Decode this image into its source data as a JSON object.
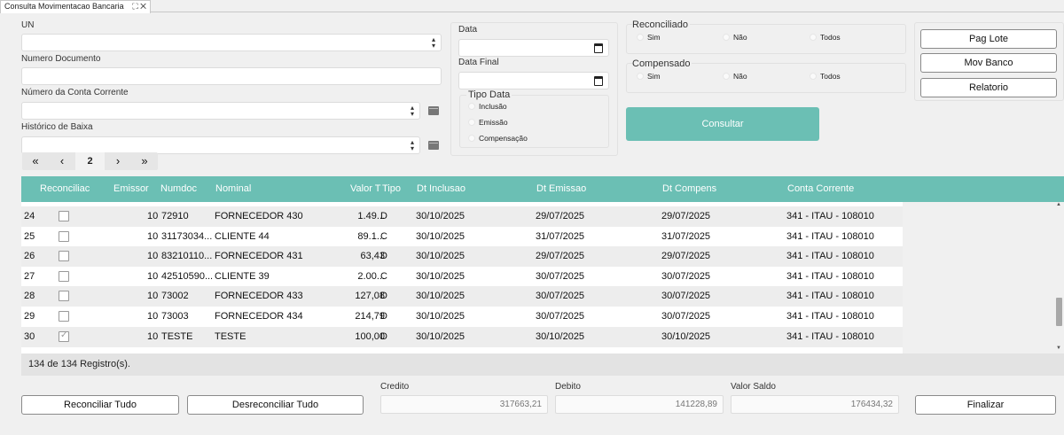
{
  "tab": {
    "title": "Consulta Movimentacao Bancaria",
    "icons": "⛶ ✕"
  },
  "filters": {
    "un_label": "UN",
    "numero_documento_label": "Numero Documento",
    "conta_corrente_label": "Número da Conta Corrente",
    "historico_baixa_label": "Histórico de Baixa",
    "data_label": "Data",
    "data_final_label": "Data Final",
    "tipo_data": {
      "label": "Tipo Data",
      "options": [
        "Inclusão",
        "Emissão",
        "Compensação"
      ]
    },
    "reconciliado": {
      "label": "Reconciliado",
      "options": [
        "Sim",
        "Não",
        "Todos"
      ]
    },
    "compensado": {
      "label": "Compensado",
      "options": [
        "Sim",
        "Não",
        "Todos"
      ]
    }
  },
  "actions": {
    "pag_lote": "Pag Lote",
    "mov_banco": "Mov Banco",
    "relatorio": "Relatorio",
    "consultar": "Consultar"
  },
  "pager": {
    "first": "«",
    "prev": "‹",
    "page": "2",
    "next": "›",
    "last": "»"
  },
  "grid": {
    "columns": [
      "Reconciliac",
      "Emissor",
      "Numdoc",
      "Nominal",
      "Valor T",
      "Tipo",
      "Dt Inclusao",
      "Dt Emissao",
      "Dt Compens",
      "Conta Corrente"
    ],
    "rows": [
      {
        "num": "24",
        "checked": false,
        "emissor": "10",
        "numdoc": "72910",
        "nominal": "FORNECEDOR 430",
        "valor": "1.49...",
        "tipo": "D",
        "dt_inclusao": "30/10/2025",
        "dt_emissao": "29/07/2025",
        "dt_compens": "29/07/2025",
        "conta": "341 - ITAU - 108010"
      },
      {
        "num": "25",
        "checked": false,
        "emissor": "10",
        "numdoc": "31173034...",
        "nominal": "CLIENTE 44",
        "valor": "89.1...",
        "tipo": "C",
        "dt_inclusao": "30/10/2025",
        "dt_emissao": "31/07/2025",
        "dt_compens": "31/07/2025",
        "conta": "341 - ITAU - 108010"
      },
      {
        "num": "26",
        "checked": false,
        "emissor": "10",
        "numdoc": "83210110...",
        "nominal": "FORNECEDOR 431",
        "valor": "63,43",
        "tipo": "D",
        "dt_inclusao": "30/10/2025",
        "dt_emissao": "29/07/2025",
        "dt_compens": "29/07/2025",
        "conta": "341 - ITAU - 108010"
      },
      {
        "num": "27",
        "checked": false,
        "emissor": "10",
        "numdoc": "42510590...",
        "nominal": "CLIENTE 39",
        "valor": "2.00...",
        "tipo": "C",
        "dt_inclusao": "30/10/2025",
        "dt_emissao": "30/07/2025",
        "dt_compens": "30/07/2025",
        "conta": "341 - ITAU - 108010"
      },
      {
        "num": "28",
        "checked": false,
        "emissor": "10",
        "numdoc": "73002",
        "nominal": "FORNECEDOR 433",
        "valor": "127,08",
        "tipo": "D",
        "dt_inclusao": "30/10/2025",
        "dt_emissao": "30/07/2025",
        "dt_compens": "30/07/2025",
        "conta": "341 - ITAU - 108010"
      },
      {
        "num": "29",
        "checked": false,
        "emissor": "10",
        "numdoc": "73003",
        "nominal": "FORNECEDOR 434",
        "valor": "214,79",
        "tipo": "D",
        "dt_inclusao": "30/10/2025",
        "dt_emissao": "30/07/2025",
        "dt_compens": "30/07/2025",
        "conta": "341 - ITAU - 108010"
      },
      {
        "num": "30",
        "checked": true,
        "emissor": "10",
        "numdoc": "TESTE",
        "nominal": "TESTE",
        "valor": "100,00",
        "tipo": "D",
        "dt_inclusao": "30/10/2025",
        "dt_emissao": "30/10/2025",
        "dt_compens": "30/10/2025",
        "conta": "341 - ITAU - 108010"
      }
    ]
  },
  "status": {
    "record_count": "134 de 134 Registro(s)."
  },
  "totals": {
    "credito_label": "Credito",
    "credito_value": "317663,21",
    "debito_label": "Debito",
    "debito_value": "141228,89",
    "saldo_label": "Valor Saldo",
    "saldo_value": "176434,32"
  },
  "footer": {
    "reconciliar_tudo": "Reconciliar Tudo",
    "desreconciliar_tudo": "Desreconciliar Tudo",
    "finalizar": "Finalizar"
  },
  "colors": {
    "accent": "#6bbfb4",
    "background": "#f0f0f0"
  }
}
